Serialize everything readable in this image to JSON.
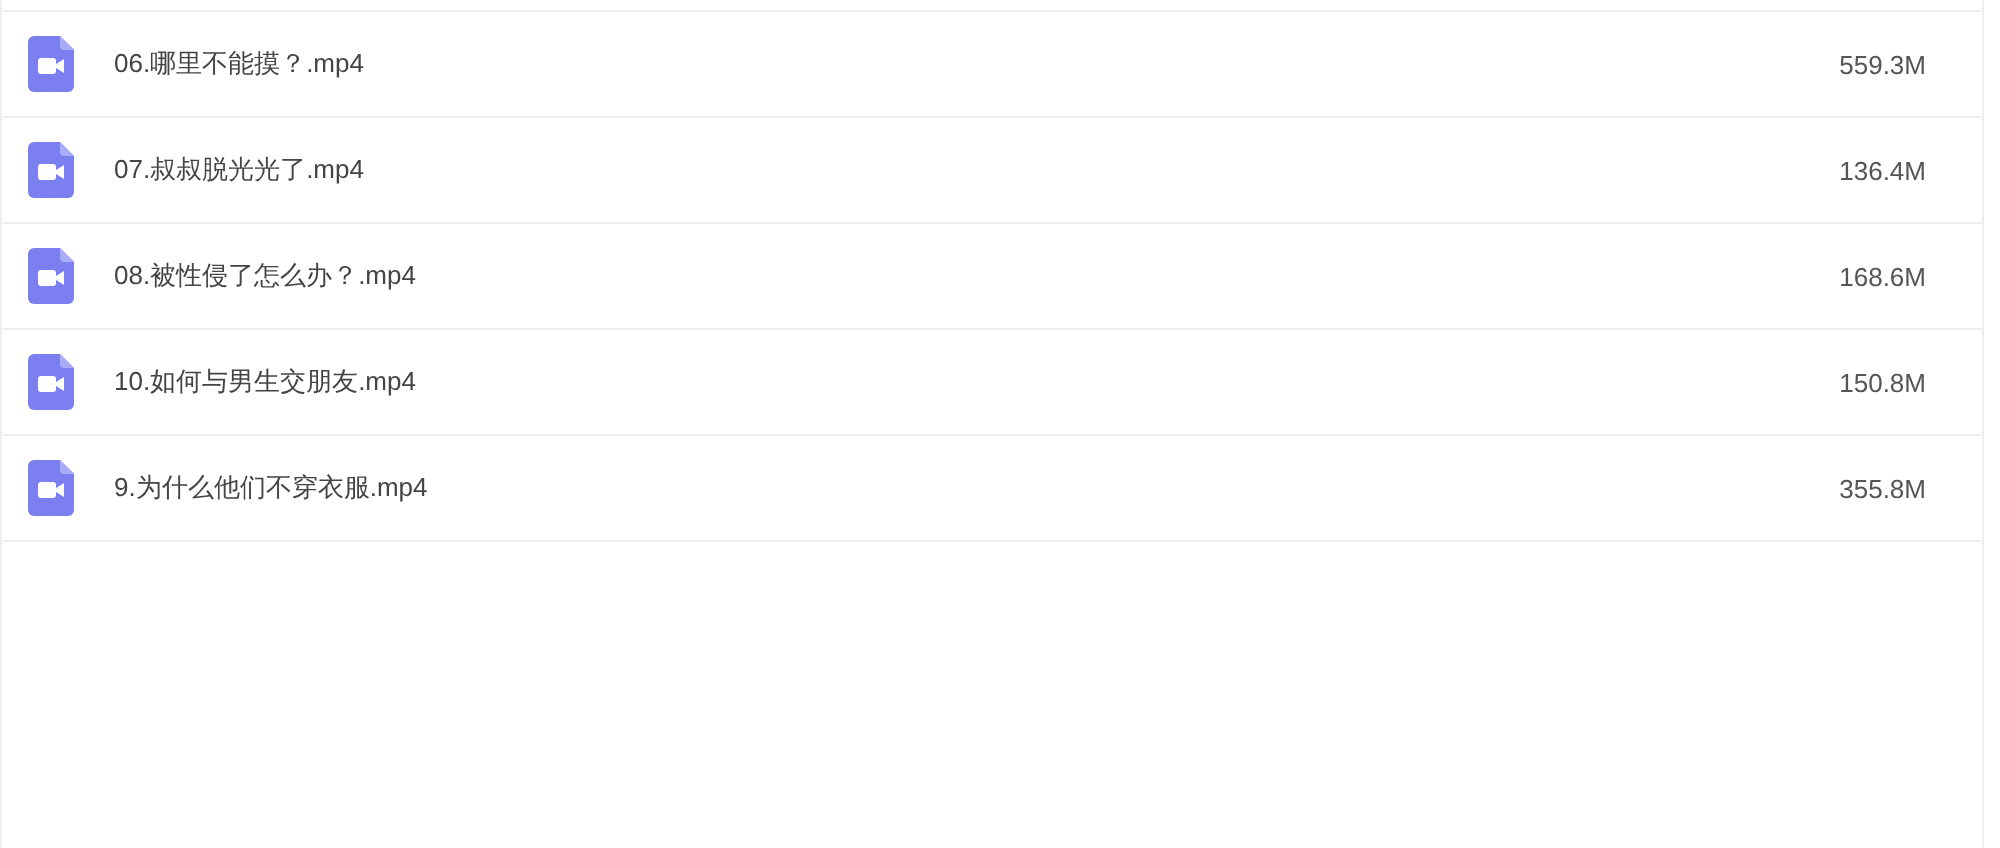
{
  "files": [
    {
      "name": "06.哪里不能摸？.mp4",
      "size": "559.3M"
    },
    {
      "name": "07.叔叔脱光光了.mp4",
      "size": "136.4M"
    },
    {
      "name": "08.被性侵了怎么办？.mp4",
      "size": "168.6M"
    },
    {
      "name": "10.如何与男生交朋友.mp4",
      "size": "150.8M"
    },
    {
      "name": "9.为什么他们不穿衣服.mp4",
      "size": "355.8M"
    }
  ]
}
